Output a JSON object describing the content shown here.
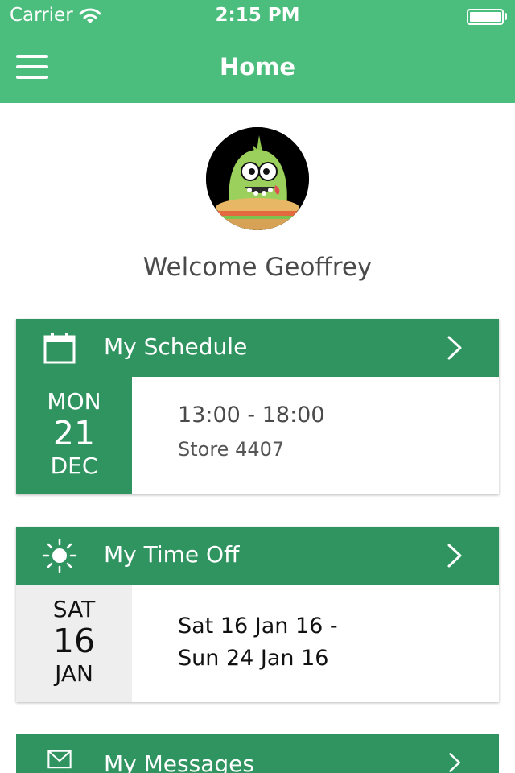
{
  "status_bar": {
    "carrier": "Carrier",
    "time": "2:15 PM",
    "icons": [
      "wifi-icon",
      "battery-icon"
    ]
  },
  "nav": {
    "title": "Home",
    "menu_icon": "hamburger-menu-icon",
    "color": "#4bbd7c"
  },
  "profile": {
    "avatar_icon": "monster-avatar",
    "welcome": "Welcome Geoffrey"
  },
  "cards": {
    "schedule": {
      "title": "My Schedule",
      "icon": "calendar-icon",
      "date": {
        "dow": "MON",
        "day": "21",
        "month": "DEC"
      },
      "time_range": "13:00 - 18:00",
      "store": "Store 4407"
    },
    "time_off": {
      "title": "My Time Off",
      "icon": "sun-icon",
      "date": {
        "dow": "SAT",
        "day": "16",
        "month": "JAN"
      },
      "range_line1": "Sat 16 Jan 16 -",
      "range_line2": "Sun 24 Jan 16"
    },
    "messages": {
      "title": "My Messages",
      "icon": "envelope-icon"
    }
  },
  "colors": {
    "header_green": "#4bbd7c",
    "card_green": "#2f9460",
    "date_grey": "#eeeeee"
  }
}
